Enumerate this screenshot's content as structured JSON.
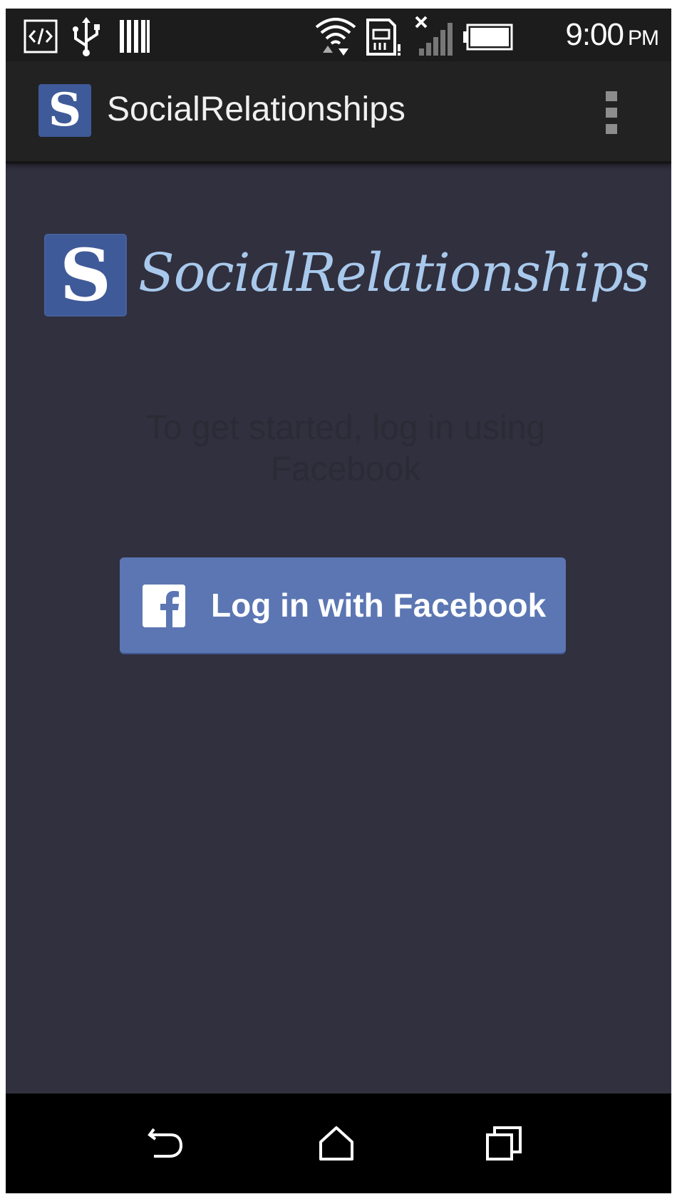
{
  "status_bar": {
    "time": "9:00",
    "ampm": "PM",
    "icons": [
      "developer-icon",
      "usb-icon",
      "barcode-icon",
      "wifi-icon",
      "sd-card-icon",
      "signal-icon",
      "battery-icon"
    ]
  },
  "action_bar": {
    "app_icon_letter": "S",
    "title": "SocialRelationships",
    "overflow_icon": "overflow-menu-icon"
  },
  "main": {
    "logo_letter": "S",
    "logo_text": "SocialRelationships",
    "intro_text": "To get started, log in using Facebook",
    "login_button_label": "Log in with Facebook",
    "login_button_icon": "facebook-icon"
  },
  "nav_bar": {
    "icons": [
      "back-icon",
      "home-icon",
      "recent-apps-icon"
    ]
  },
  "colors": {
    "background": "#31303f",
    "action_bar": "#222222",
    "brand_blue": "#3f5a98",
    "facebook_blue": "#5b76b3",
    "logo_text": "#a8c9ec"
  }
}
